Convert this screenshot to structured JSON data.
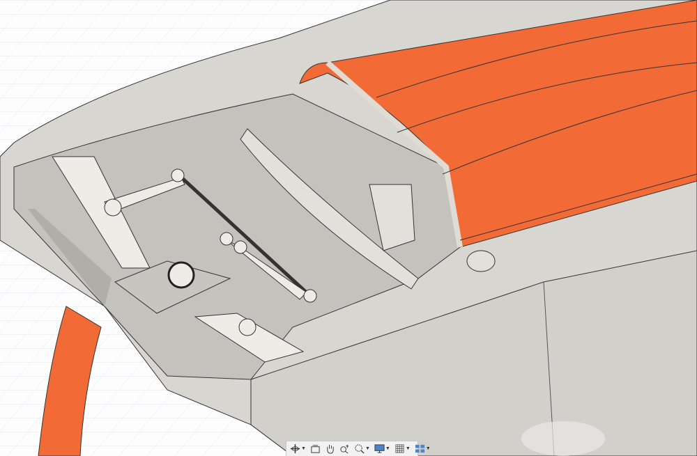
{
  "app": "CAD viewport",
  "colors": {
    "hull": "#d8d6d0",
    "hull_shadow": "#b9b7b1",
    "deck": "#f26a35",
    "grid": "#dfe3ea",
    "background": "#fdfdfd"
  },
  "toolbar": {
    "items": [
      {
        "icon": "orbit-icon",
        "dropdown": true
      },
      {
        "icon": "look-at-icon",
        "dropdown": false
      },
      {
        "icon": "pan-icon",
        "dropdown": false
      },
      {
        "icon": "zoom-icon",
        "dropdown": false
      },
      {
        "icon": "fit-icon",
        "dropdown": true
      },
      {
        "icon": "display-settings-icon",
        "dropdown": true
      },
      {
        "icon": "grid-settings-icon",
        "dropdown": true
      },
      {
        "icon": "viewports-icon",
        "dropdown": true
      }
    ]
  }
}
